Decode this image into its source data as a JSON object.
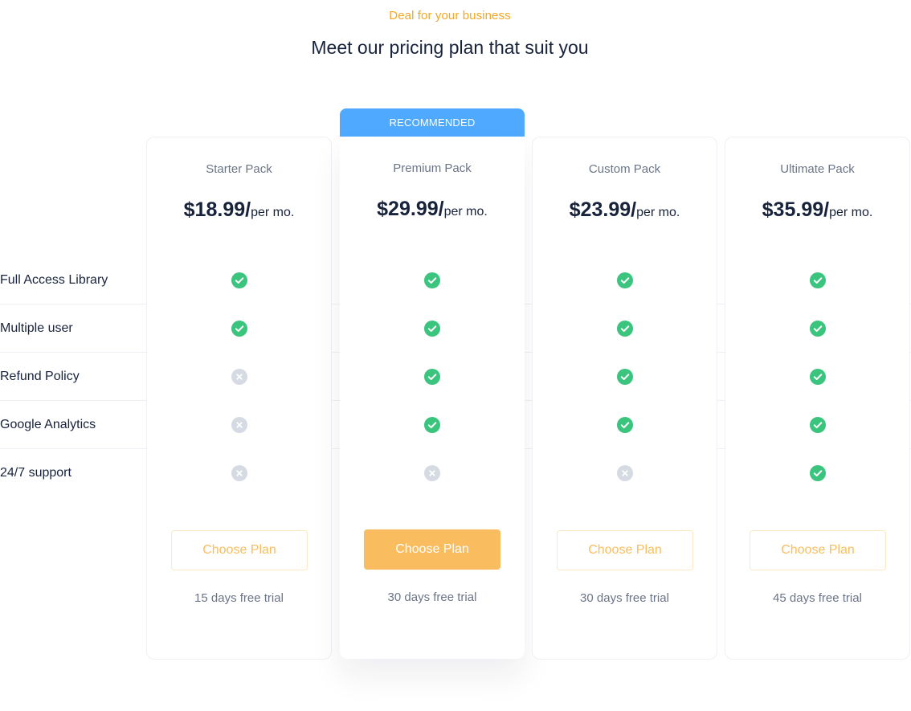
{
  "header": {
    "eyebrow": "Deal for your business",
    "title": "Meet our pricing plan that suit you"
  },
  "badge": "RECOMMENDED",
  "features": [
    "Full Access Library",
    "Multiple user",
    "Refund Policy",
    "Google Analytics",
    "24/7 support"
  ],
  "plans": [
    {
      "name": "Starter Pack",
      "price": "$18.99/",
      "period": "per mo.",
      "button": "Choose Plan",
      "trial": "15 days free trial",
      "included": [
        true,
        true,
        false,
        false,
        false
      ]
    },
    {
      "name": "Premium Pack",
      "price": "$29.99/",
      "period": "per mo.",
      "button": "Choose Plan",
      "trial": "30 days free trial",
      "included": [
        true,
        true,
        true,
        true,
        false
      ]
    },
    {
      "name": "Custom Pack",
      "price": "$23.99/",
      "period": "per mo.",
      "button": "Choose Plan",
      "trial": "30 days free trial",
      "included": [
        true,
        true,
        true,
        true,
        false
      ]
    },
    {
      "name": "Ultimate Pack",
      "price": "$35.99/",
      "period": "per mo.",
      "button": "Choose Plan",
      "trial": "45 days free trial",
      "included": [
        true,
        true,
        true,
        true,
        true
      ]
    }
  ],
  "colors": {
    "accent": "#f9bd5f",
    "eyebrow": "#f5a623",
    "badge": "#4fa9ff",
    "check": "#3ac47d",
    "cross": "#d5dae3",
    "text": "#17223b",
    "muted": "#6b7587"
  },
  "icons": {
    "included": "check-circle-icon",
    "excluded": "x-circle-icon"
  }
}
